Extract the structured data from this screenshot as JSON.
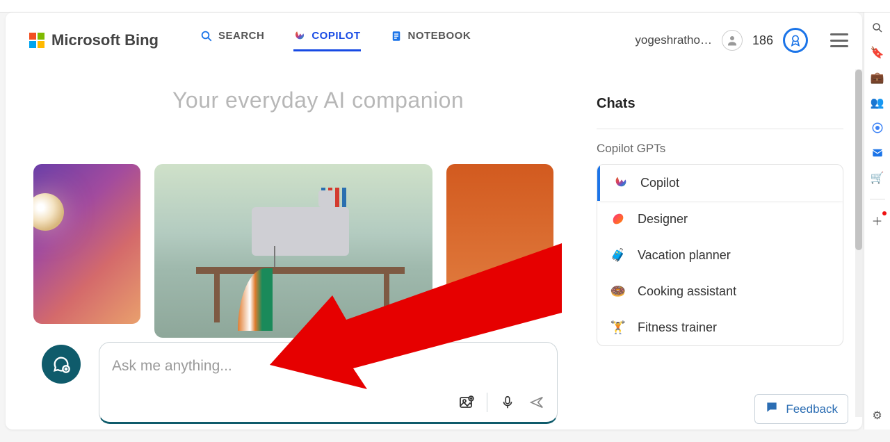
{
  "brand": {
    "text": "Microsoft Bing"
  },
  "tabs": {
    "search": "SEARCH",
    "copilot": "COPILOT",
    "notebook": "NOTEBOOK",
    "active": "copilot"
  },
  "user": {
    "name": "yogeshratho…",
    "points": "186"
  },
  "hero": {
    "title": "Your everyday AI companion"
  },
  "chat": {
    "placeholder": "Ask me anything..."
  },
  "sidebar": {
    "chats_title": "Chats",
    "gpts_title": "Copilot GPTs",
    "items": [
      {
        "label": "Copilot",
        "icon": "copilot",
        "active": true
      },
      {
        "label": "Designer",
        "icon": "designer",
        "active": false
      },
      {
        "label": "Vacation planner",
        "icon": "suitcase",
        "active": false
      },
      {
        "label": "Cooking assistant",
        "icon": "donut",
        "active": false
      },
      {
        "label": "Fitness trainer",
        "icon": "dumbbell",
        "active": false
      }
    ]
  },
  "feedback": {
    "label": "Feedback"
  },
  "colors": {
    "accent_blue": "#174ae4",
    "teal": "#0f5b6b",
    "arrow_red": "#e60000"
  }
}
